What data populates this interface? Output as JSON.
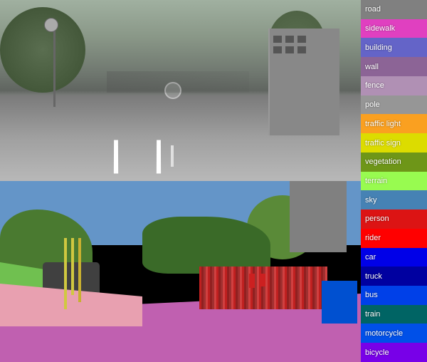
{
  "legend": {
    "items": [
      {
        "id": "road",
        "label": "road",
        "color": "#808080"
      },
      {
        "id": "sidewalk",
        "label": "sidewalk",
        "color": "#e040c0"
      },
      {
        "id": "building",
        "label": "building",
        "color": "#6464c8"
      },
      {
        "id": "wall",
        "label": "wall",
        "color": "#8c6496"
      },
      {
        "id": "fence",
        "label": "fence",
        "color": "#b090b4"
      },
      {
        "id": "pole",
        "label": "pole",
        "color": "#969696"
      },
      {
        "id": "traffic_light",
        "label": "traffic light",
        "color": "#faa020"
      },
      {
        "id": "traffic_sign",
        "label": "traffic sign",
        "color": "#dcdc00"
      },
      {
        "id": "vegetation",
        "label": "vegetation",
        "color": "#6e9618"
      },
      {
        "id": "terrain",
        "label": "terrain",
        "color": "#98fb50"
      },
      {
        "id": "sky",
        "label": "sky",
        "color": "#4682b4"
      },
      {
        "id": "person",
        "label": "person",
        "color": "#dc1414"
      },
      {
        "id": "rider",
        "label": "rider",
        "color": "#ff0000"
      },
      {
        "id": "car",
        "label": "car",
        "color": "#0000e8"
      },
      {
        "id": "truck",
        "label": "truck",
        "color": "#0000a0"
      },
      {
        "id": "bus",
        "label": "bus",
        "color": "#0040e8"
      },
      {
        "id": "train",
        "label": "train",
        "color": "#006464"
      },
      {
        "id": "motorcycle",
        "label": "motorcycle",
        "color": "#0050e8"
      },
      {
        "id": "bicycle",
        "label": "bicycle",
        "color": "#7800e8"
      }
    ]
  }
}
